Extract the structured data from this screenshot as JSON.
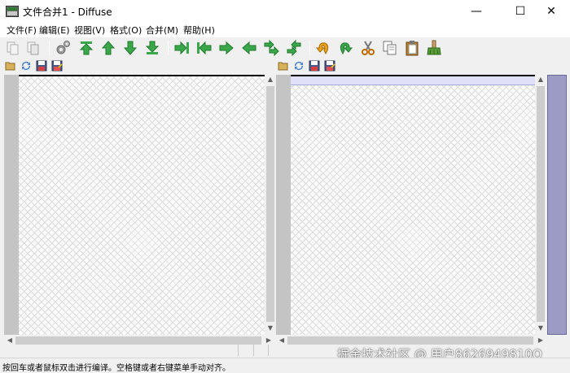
{
  "window": {
    "title": "文件合并1 - Diffuse",
    "minimize": "—",
    "maximize": "☐",
    "close": "✕"
  },
  "menu": [
    "文件(F)",
    "编辑(E)",
    "视图(V)",
    "格式(O)",
    "合并(M)",
    "帮助(H)"
  ],
  "toolbar": {
    "icons": [
      "copy-icon",
      "paste-icon",
      "settings-icon",
      "first-difference-icon",
      "previous-difference-icon",
      "next-difference-icon",
      "last-difference-icon",
      "merge-from-left-icon",
      "merge-from-right-icon",
      "shift-right-icon",
      "shift-left-icon",
      "swap-down-icon",
      "swap-up-icon",
      "undo-icon",
      "redo-icon",
      "cut-icon",
      "copy-selection-icon",
      "clipboard-icon",
      "clear-edits-icon"
    ],
    "colors": {
      "green": "#3aa84a",
      "orange": "#e8a21b"
    }
  },
  "pane_toolbar": {
    "icons": [
      "open-file-icon",
      "reload-icon",
      "save-icon",
      "save-as-icon"
    ]
  },
  "status": {
    "message": "按回车或者鼠标双击进行编译。空格键或者右键菜单手动对齐。"
  },
  "watermark": "掘金技术社区 @ 用户8626949810O"
}
